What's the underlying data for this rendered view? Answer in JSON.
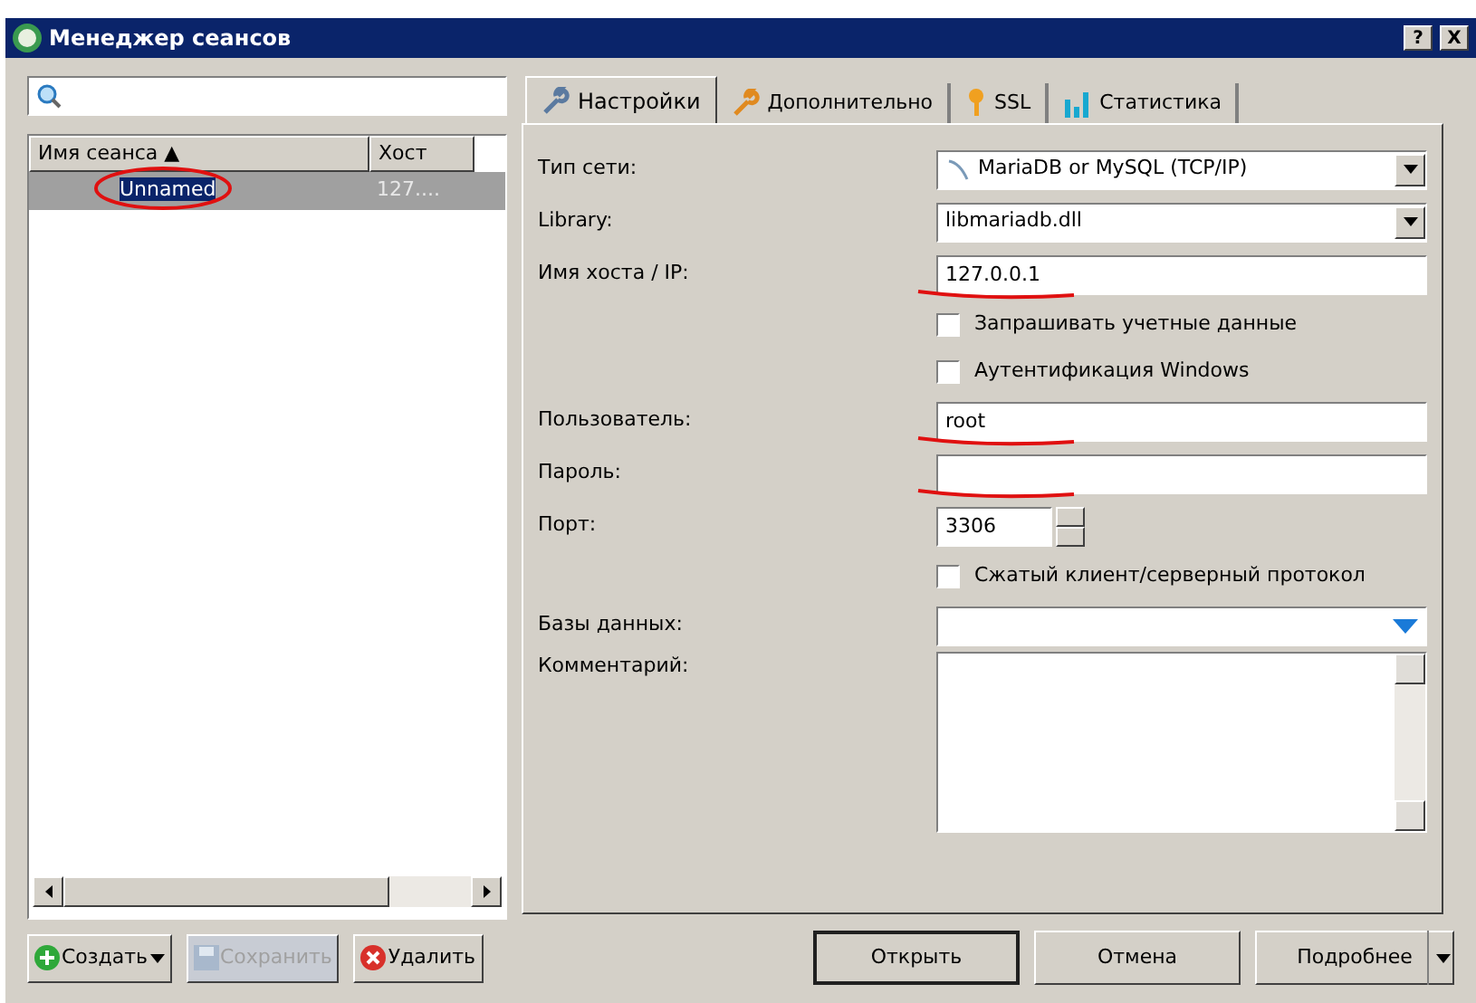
{
  "window": {
    "title": "Менеджер сеансов",
    "buttons": [
      "?",
      "X"
    ]
  },
  "sessions": {
    "columns": [
      "Имя сеанса ▲",
      "Хост"
    ],
    "rows": [
      {
        "name": "Unnamed",
        "host": "127....",
        "selected": true,
        "circled": true
      }
    ]
  },
  "tabs": [
    {
      "label": "Настройки",
      "selected": true
    },
    {
      "label": "Дополнительно",
      "selected": false
    },
    {
      "label": "SSL",
      "selected": false
    },
    {
      "label": "Статистика",
      "selected": false
    }
  ],
  "form": [
    {
      "kind": "select",
      "label": "Тип сети:",
      "value": "MariaDB or MySQL (TCP/IP)",
      "icon": true
    },
    {
      "kind": "select",
      "label": "Library:",
      "value": "libmariadb.dll",
      "icon": false
    },
    {
      "kind": "text",
      "label": "Имя хоста / IP:",
      "value": "127.0.0.1",
      "underlined": true
    },
    {
      "kind": "checkbox",
      "label": "Запрашивать учетные данные",
      "checked": false
    },
    {
      "kind": "checkbox",
      "label": "Аутентификация Windows",
      "checked": false
    },
    {
      "kind": "text",
      "label": "Пользователь:",
      "value": "root",
      "underlined": true
    },
    {
      "kind": "text",
      "label": "Пароль:",
      "underlined": true
    },
    {
      "kind": "spin",
      "label": "Порт:",
      "value": "3306"
    },
    {
      "kind": "checkbox",
      "label": "Сжатый клиент/серверный протокол",
      "checked": false
    },
    {
      "kind": "combo",
      "label": "Базы данных:"
    },
    {
      "kind": "memo",
      "label": "Комментарий:"
    }
  ],
  "left_buttons": [
    {
      "label": "Создать",
      "dropdown": true,
      "disabled": false
    },
    {
      "label": "Сохранить",
      "dropdown": false,
      "disabled": true
    },
    {
      "label": "Удалить",
      "dropdown": false,
      "disabled": false
    }
  ],
  "right_buttons": [
    {
      "label": "Открыть",
      "dropdown": false,
      "default": true
    },
    {
      "label": "Отмена",
      "dropdown": false,
      "default": false
    },
    {
      "label": "Подробнее",
      "dropdown": true,
      "default": false
    }
  ]
}
